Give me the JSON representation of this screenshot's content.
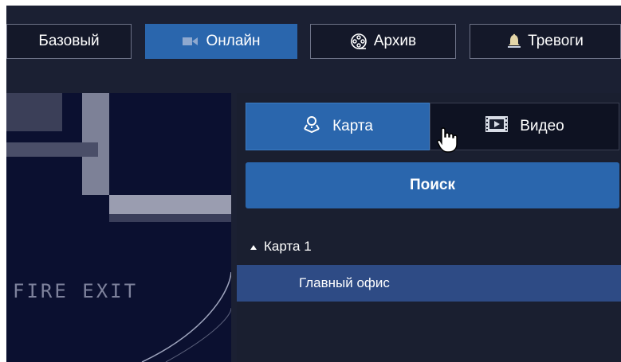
{
  "toolbar": {
    "tabs": [
      {
        "label": "Базовый",
        "icon": "none",
        "active": false
      },
      {
        "label": "Онлайн",
        "icon": "video-camera-icon",
        "active": true
      },
      {
        "label": "Архив",
        "icon": "film-reel-icon",
        "active": false
      },
      {
        "label": "Тревоги",
        "icon": "bell-icon",
        "active": false
      }
    ]
  },
  "video": {
    "sign_text": "FIRE EXIT"
  },
  "panel": {
    "segments": {
      "map_label": "Карта",
      "video_label": "Видео"
    },
    "search_label": "Поиск",
    "tree": {
      "node_label": "Карта 1",
      "leaf_label": "Главный офис"
    }
  },
  "colors": {
    "background": "#1b2033",
    "accent": "#2a66ad",
    "selected_row": "#2e4b85"
  }
}
